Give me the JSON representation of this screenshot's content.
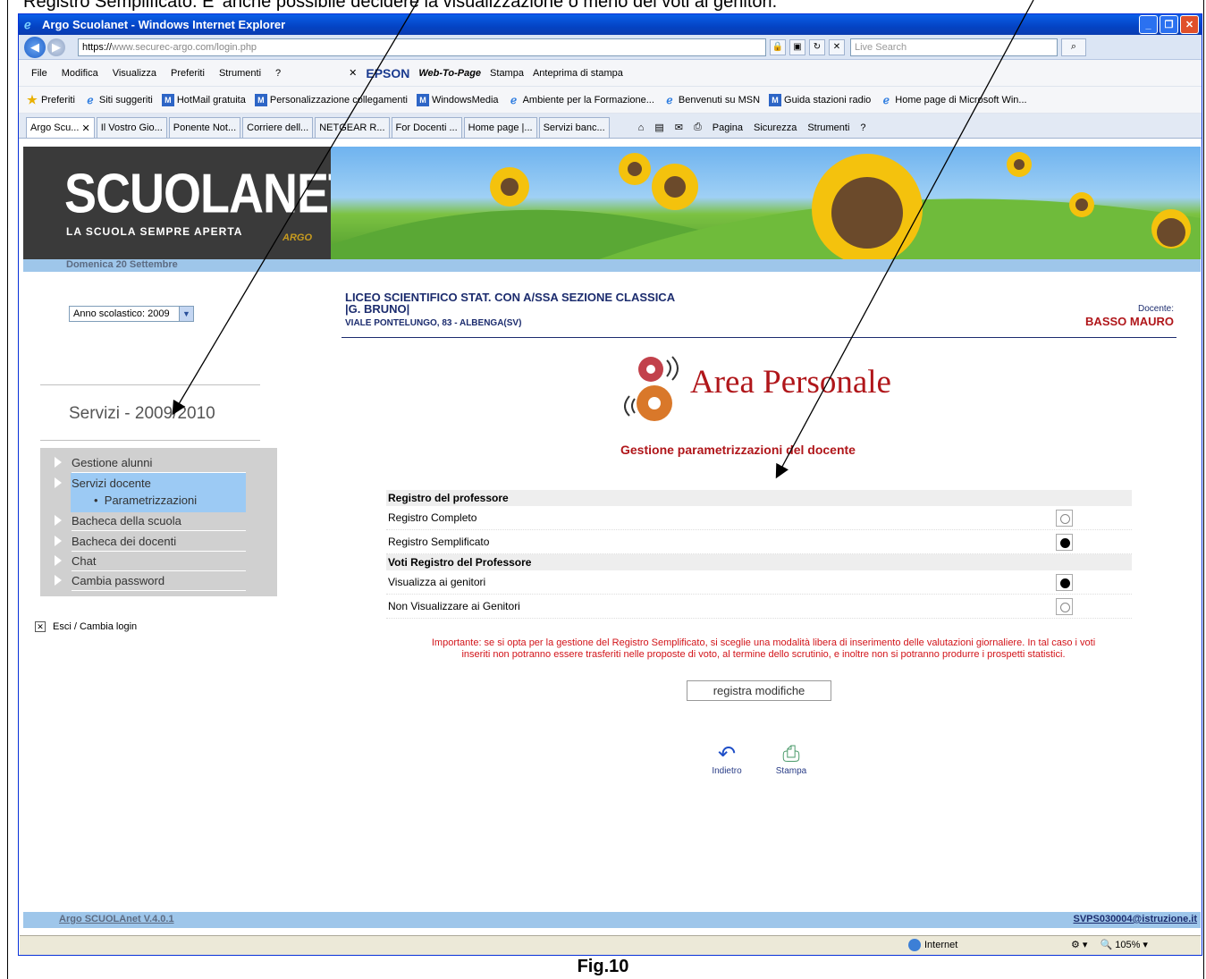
{
  "document": {
    "top_caption": "Registro Semplificato. E' anche possibile decidere la visualizzazione o meno dei voti ai genitori.",
    "figure_caption": "Fig.10"
  },
  "window": {
    "title": "Argo Scuolanet - Windows Internet Explorer",
    "url_scheme": "https://",
    "url_host": "www.securec-argo.com/login.php",
    "search_placeholder": "Live Search"
  },
  "menubar": {
    "items": [
      "File",
      "Modifica",
      "Visualizza",
      "Preferiti",
      "Strumenti",
      "?"
    ],
    "epson": "EPSON",
    "webtopage": "Web-To-Page",
    "stampa": "Stampa",
    "anteprima": "Anteprima di stampa"
  },
  "favorites": {
    "label": "Preferiti",
    "items": [
      "Siti suggeriti",
      "HotMail gratuita",
      "Personalizzazione collegamenti",
      "WindowsMedia",
      "Ambiente per la Formazione...",
      "Benvenuti su MSN",
      "Guida stazioni radio",
      "Home page di Microsoft Win..."
    ]
  },
  "tabs": {
    "items": [
      "Argo Scu...",
      "Il Vostro Gio...",
      "Ponente Not...",
      "Corriere dell...",
      "NETGEAR R...",
      "For Docenti ...",
      "Home page |...",
      "Servizi banc..."
    ],
    "tools": [
      "Pagina",
      "Sicurezza",
      "Strumenti"
    ]
  },
  "banner": {
    "brand": "SCUOLANET",
    "tagline": "LA SCUOLA SEMPRE APERTA",
    "argo": "ARGO",
    "date": "Domenica 20 Settembre"
  },
  "sidebar": {
    "year_select": "Anno scolastico: 2009",
    "services_title": "Servizi - 2009/2010",
    "menu": [
      "Gestione alunni",
      "Servizi docente",
      "Bacheca della scuola",
      "Bacheca dei docenti",
      "Chat",
      "Cambia password"
    ],
    "submenu": "Parametrizzazioni",
    "exit": "Esci / Cambia login"
  },
  "school": {
    "name_line1": "LICEO SCIENTIFICO STAT. CON A/SSA SEZIONE CLASSICA",
    "name_line2": "|G. BRUNO|",
    "address": "VIALE PONTELUNGO, 83 - ALBENGA(SV)",
    "docente_label": "Docente:",
    "docente_name": "BASSO MAURO"
  },
  "main": {
    "area_title": "Area Personale",
    "subtitle": "Gestione parametrizzazioni del docente",
    "sections": [
      {
        "header": "Registro del professore",
        "options": [
          {
            "label": "Registro Completo",
            "selected": false
          },
          {
            "label": "Registro Semplificato",
            "selected": true
          }
        ]
      },
      {
        "header": "Voti Registro del Professore",
        "options": [
          {
            "label": "Visualizza ai genitori",
            "selected": true
          },
          {
            "label": "Non Visualizzare ai Genitori",
            "selected": false
          }
        ]
      }
    ],
    "note_line1": "Importante: se si opta per la gestione del Registro Semplificato, si sceglie una modalità libera di inserimento delle valutazioni giornaliere. In tal caso i voti",
    "note_line2": "inseriti non potranno essere trasferiti nelle proposte di voto, al termine dello scrutinio, e inoltre non si potranno produrre i prospetti statistici.",
    "submit": "registra modifiche",
    "back": "Indietro",
    "print": "Stampa"
  },
  "footer": {
    "version": "Argo SCUOLAnet V.4.0.1",
    "email": "SVPS030004@istruzione.it"
  },
  "statusbar": {
    "zone": "Internet",
    "zoom": "105%"
  }
}
